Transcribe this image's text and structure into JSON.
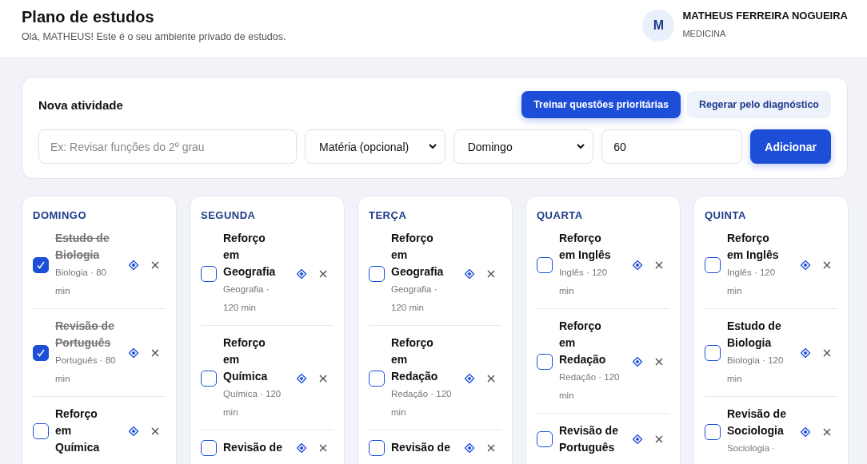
{
  "header": {
    "title": "Plano de estudos",
    "subtitle": "Olá, MATHEUS! Este é o seu ambiente privado de estudos.",
    "user": {
      "initial": "M",
      "name": "MATHEUS FERREIRA NOGUEIRA",
      "course": "MEDICINA"
    }
  },
  "new_activity": {
    "title": "Nova atividade",
    "buttons": [
      {
        "label": "Treinar questões prioritárias",
        "kind": "primary"
      },
      {
        "label": "Regerar pelo diagnóstico",
        "kind": "secondary"
      }
    ],
    "description": {
      "placeholder": "Ex: Revisar funções do 2º grau"
    },
    "subject": {
      "value": "Matéria (opcional)"
    },
    "day": {
      "value": "Domingo"
    },
    "minutes": {
      "value": "60"
    },
    "submit": "Adicionar"
  },
  "days": [
    {
      "name": "DOMINGO",
      "tasks": [
        {
          "title": "Estudo de Biologia",
          "meta": "Biologia · 80 min",
          "done": true
        },
        {
          "title": "Revisão de Português",
          "meta": "Português · 80 min",
          "done": true
        },
        {
          "title": "Reforço em Química",
          "done": false
        }
      ]
    },
    {
      "name": "SEGUNDA",
      "tasks": [
        {
          "title": "Reforço em Geografia",
          "meta": "Geografia · 120 min",
          "done": false
        },
        {
          "title": "Reforço em Química",
          "meta": "Química · 120 min",
          "done": false
        },
        {
          "title": "Revisão de",
          "done": false
        }
      ]
    },
    {
      "name": "TERÇA",
      "tasks": [
        {
          "title": "Reforço em Geografia",
          "meta": "Geografia · 120 min",
          "done": false
        },
        {
          "title": "Reforço em Redação",
          "meta": "Redação · 120 min",
          "done": false
        },
        {
          "title": "Revisão de",
          "done": false
        }
      ]
    },
    {
      "name": "QUARTA",
      "tasks": [
        {
          "title": "Reforço em Inglês",
          "meta": "Inglês · 120 min",
          "done": false
        },
        {
          "title": "Reforço em Redação",
          "meta": "Redação · 120 min",
          "done": false
        },
        {
          "title": "Revisão de Português",
          "done": false
        }
      ]
    },
    {
      "name": "QUINTA",
      "tasks": [
        {
          "title": "Reforço em Inglês",
          "meta": "Inglês · 120 min",
          "done": false
        },
        {
          "title": "Estudo de Biologia",
          "meta": "Biologia · 120 min",
          "done": false
        },
        {
          "title": "Revisão de Sociologia",
          "meta": "Sociologia ·",
          "done": false
        }
      ]
    }
  ]
}
